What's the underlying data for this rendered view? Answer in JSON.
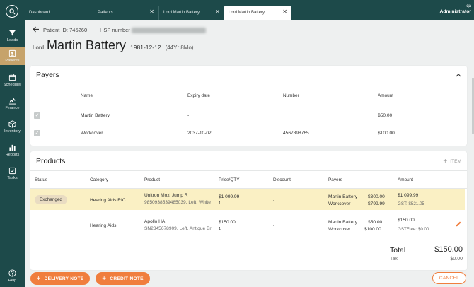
{
  "sidebar": {
    "items": [
      {
        "label": "Leads",
        "icon": "leads-icon"
      },
      {
        "label": "Patients",
        "icon": "patients-icon"
      },
      {
        "label": "Scheduler",
        "icon": "calendar-icon"
      },
      {
        "label": "Finance",
        "icon": "finance-icon"
      },
      {
        "label": "Inventory",
        "icon": "box-icon"
      },
      {
        "label": "Reports",
        "icon": "bar-chart-icon"
      },
      {
        "label": "Tasks",
        "icon": "checklist-icon"
      },
      {
        "label": "Help",
        "icon": "help-icon"
      }
    ],
    "active": "Patients",
    "accent": "#c6a36b",
    "bg": "#1d4a4a"
  },
  "tabs": [
    {
      "label": "Dashboard",
      "closable": false
    },
    {
      "label": "Patients",
      "closable": true
    },
    {
      "label": "Lord Martin Battery",
      "closable": true
    },
    {
      "label": "Lord Martin Battery",
      "closable": true,
      "active": true
    }
  ],
  "user": {
    "line1": "qa",
    "line2": "Administrator"
  },
  "patient": {
    "id_label": "Patient ID: 745260",
    "hsp_label": "HSP number",
    "prefix": "Lord",
    "name": "Martin Battery",
    "dob": "1981-12-12",
    "age": "(44Yr 8Mo)"
  },
  "payers": {
    "title": "Payers",
    "headers": [
      "Name",
      "Expiry date",
      "Number",
      "Amount"
    ],
    "rows": [
      {
        "name": "Martin Battery",
        "expiry": "-",
        "number": "",
        "amount": "$50.00"
      },
      {
        "name": "Workcover",
        "expiry": "2037-10-02",
        "number": "4567898765",
        "amount": "$100.00"
      }
    ]
  },
  "products": {
    "title": "Products",
    "add_item_label": "ITEM",
    "headers": [
      "Status",
      "Category",
      "Product",
      "Price/QTY",
      "Discount",
      "Payers",
      "Amount"
    ],
    "rows": [
      {
        "status": "Exchanged",
        "category": "Hearing Aids RIC",
        "product_name": "Unitron Moxi Jump R",
        "product_detail": "985093853948503​9, Left, White",
        "price": "$1 099.99",
        "qty": "1",
        "discount": "-",
        "payer1_name": "Martin Battery",
        "payer1_amount": "$300.00",
        "payer2_name": "Workcover",
        "payer2_amount": "$799.99",
        "amount": "$1 099.99",
        "gst": "GST: $521.05",
        "highlight": true
      },
      {
        "status": "",
        "category": "Hearing Aids",
        "product_name": "Apollo HA",
        "product_detail": "SN2345678909, Left, Antique Br",
        "price": "$150.00",
        "qty": "1",
        "discount": "-",
        "payer1_name": "Martin Battery",
        "payer1_amount": "$50.00",
        "payer2_name": "Workcover",
        "payer2_amount": "$100.00",
        "amount": "$150.00",
        "gst": "GSTFree: $0.00",
        "highlight": false
      }
    ],
    "total_label": "Total",
    "total_value": "$150.00",
    "tax_label": "Tax",
    "tax_value": "$0.00"
  },
  "buttons": {
    "delivery_note": "DELIVERY NOTE",
    "credit_note": "CREDIT NOTE",
    "cancel": "CANCEL"
  },
  "colors": {
    "orange": "#f07e3e",
    "highlight": "#faf0c4",
    "teal": "#1d4a4a"
  }
}
